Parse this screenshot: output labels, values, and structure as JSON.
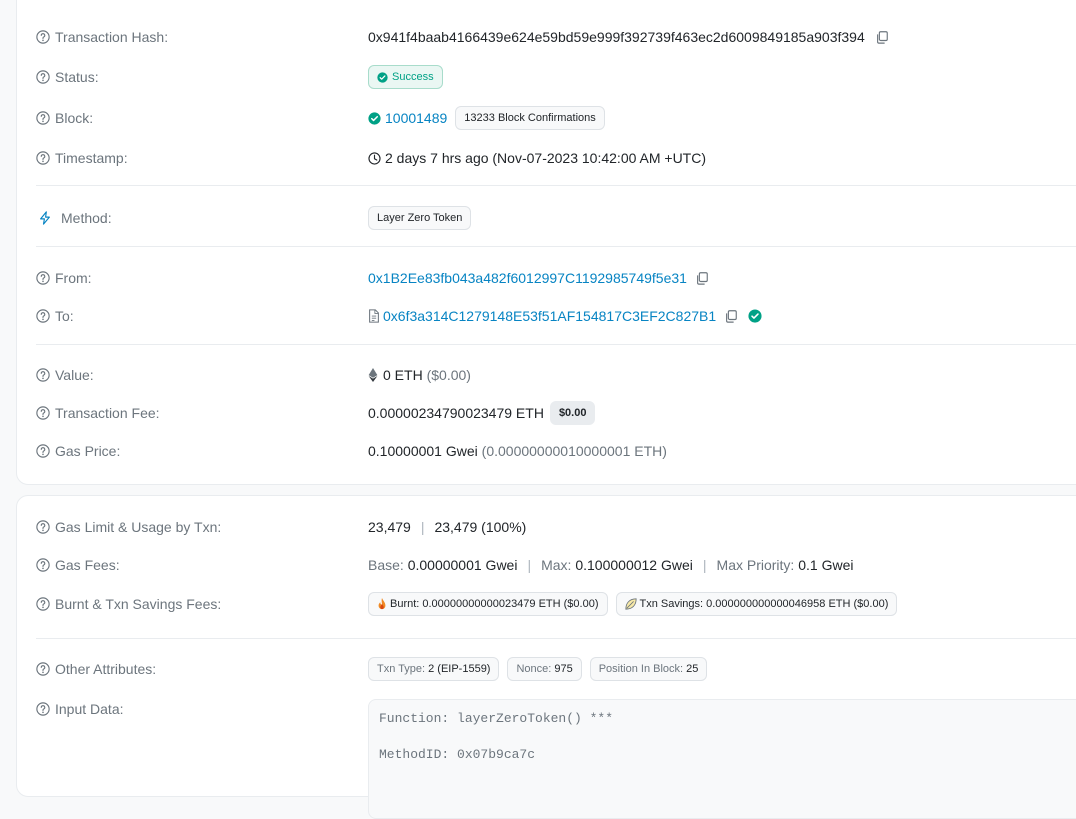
{
  "overview": {
    "tx_hash": {
      "label": "Transaction Hash:",
      "value": "0x941f4baab4166439e624e59bd59e999f392739f463ec2d6009849185a903f394"
    },
    "status": {
      "label": "Status:",
      "value": "Success"
    },
    "block": {
      "label": "Block:",
      "number": "10001489",
      "confirmations": "13233 Block Confirmations"
    },
    "timestamp": {
      "label": "Timestamp:",
      "value": "2 days 7 hrs ago (Nov-07-2023 10:42:00 AM +UTC)"
    },
    "method": {
      "label": "Method:",
      "value": "Layer Zero Token"
    },
    "from": {
      "label": "From:",
      "value": "0x1B2Ee83fb043a482f6012997C1192985749f5e31"
    },
    "to": {
      "label": "To:",
      "value": "0x6f3a314C1279148E53f51AF154817C3EF2C827B1"
    },
    "value": {
      "label": "Value:",
      "amount": "0 ETH",
      "usd": "($0.00)"
    },
    "tx_fee": {
      "label": "Transaction Fee:",
      "amount": "0.00000234790023479 ETH",
      "usd": "$0.00"
    },
    "gas_price": {
      "label": "Gas Price:",
      "gwei": "0.10000001 Gwei",
      "eth": "(0.00000000010000001 ETH)"
    }
  },
  "more": {
    "gas_limit": {
      "label": "Gas Limit & Usage by Txn:",
      "limit": "23,479",
      "usage": "23,479 (100%)"
    },
    "gas_fees": {
      "label": "Gas Fees:",
      "base_k": "Base:",
      "base_v": "0.00000001 Gwei",
      "max_k": "Max:",
      "max_v": "0.100000012 Gwei",
      "prio_k": "Max Priority:",
      "prio_v": "0.1 Gwei"
    },
    "burnt": {
      "label": "Burnt & Txn Savings Fees:",
      "burnt_k": "Burnt:",
      "burnt_v": "0.00000000000023479 ETH ($0.00)",
      "savings_k": "Txn Savings:",
      "savings_v": "0.000000000000046958 ETH ($0.00)"
    },
    "other": {
      "label": "Other Attributes:",
      "type_k": "Txn Type:",
      "type_v": "2 (EIP-1559)",
      "nonce_k": "Nonce:",
      "nonce_v": "975",
      "pos_k": "Position In Block:",
      "pos_v": "25"
    },
    "input": {
      "label": "Input Data:",
      "line1": "Function: layerZeroToken() ***",
      "line2": "",
      "line3": "MethodID: 0x07b9ca7c"
    }
  },
  "colors": {
    "link": "#0784c3",
    "success": "#00a186",
    "muted": "#6c757d"
  },
  "icons": [
    "question-circle-icon",
    "copy-icon",
    "check-circle-icon",
    "clock-icon",
    "lightning-icon",
    "file-icon",
    "eth-icon",
    "fire-icon",
    "leaf-icon"
  ]
}
